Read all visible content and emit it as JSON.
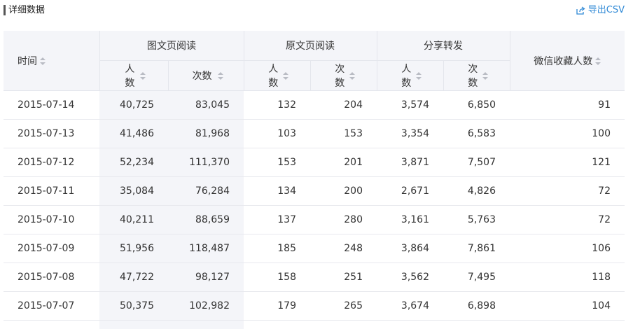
{
  "header": {
    "title": "详细数据",
    "export_label": "导出CSV",
    "accent_color": "#2f89d6"
  },
  "table": {
    "col_time": "时间",
    "group_graphic": "图文页阅读",
    "group_original": "原文页阅读",
    "group_share": "分享转发",
    "col_favorite": "微信收藏人数",
    "sub_people": "人数",
    "sub_times": "次数",
    "rows": [
      {
        "date": "2015-07-14",
        "graphic_people": "40,725",
        "graphic_times": "83,045",
        "original_people": "132",
        "original_times": "204",
        "share_people": "3,574",
        "share_times": "6,850",
        "favorite": "91"
      },
      {
        "date": "2015-07-13",
        "graphic_people": "41,486",
        "graphic_times": "81,968",
        "original_people": "103",
        "original_times": "153",
        "share_people": "3,354",
        "share_times": "6,583",
        "favorite": "100"
      },
      {
        "date": "2015-07-12",
        "graphic_people": "52,234",
        "graphic_times": "111,370",
        "original_people": "153",
        "original_times": "201",
        "share_people": "3,871",
        "share_times": "7,507",
        "favorite": "121"
      },
      {
        "date": "2015-07-11",
        "graphic_people": "35,084",
        "graphic_times": "76,284",
        "original_people": "134",
        "original_times": "200",
        "share_people": "2,671",
        "share_times": "4,826",
        "favorite": "72"
      },
      {
        "date": "2015-07-10",
        "graphic_people": "40,211",
        "graphic_times": "88,659",
        "original_people": "137",
        "original_times": "280",
        "share_people": "3,161",
        "share_times": "5,763",
        "favorite": "72"
      },
      {
        "date": "2015-07-09",
        "graphic_people": "51,956",
        "graphic_times": "118,487",
        "original_people": "185",
        "original_times": "248",
        "share_people": "3,864",
        "share_times": "7,861",
        "favorite": "106"
      },
      {
        "date": "2015-07-08",
        "graphic_people": "47,722",
        "graphic_times": "98,127",
        "original_people": "158",
        "original_times": "251",
        "share_people": "3,562",
        "share_times": "7,495",
        "favorite": "118"
      },
      {
        "date": "2015-07-07",
        "graphic_people": "50,375",
        "graphic_times": "102,982",
        "original_people": "179",
        "original_times": "265",
        "share_people": "3,674",
        "share_times": "6,898",
        "favorite": "104"
      }
    ]
  }
}
